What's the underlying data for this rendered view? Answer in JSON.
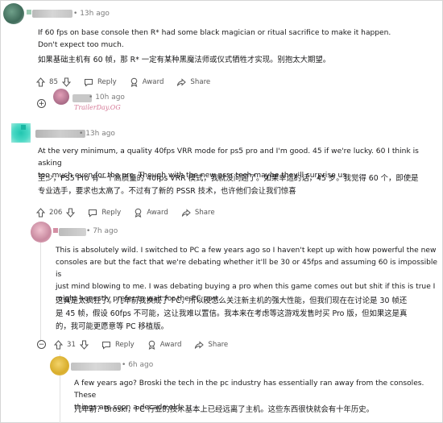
{
  "comments": [
    {
      "time": "13h ago",
      "text_en": "If 60 fps on base console then R* had some black magician or ritual sacrifice to make it happen. Don't expect too much.",
      "text_zh": "如果基础主机有 60 帧，那 R* 一定有某种黑魔法师或仪式牺牲才实现。别抱太大期望。",
      "votes": "85",
      "reply": "Reply",
      "award": "Award",
      "share": "Share"
    },
    {
      "time": "10h ago",
      "flair": "TrailerDay.OG"
    },
    {
      "time": "13h ago",
      "text_en_lines": [
        "At the very minimum, a quality 40fps VRR mode for ps5 pro and I'm good. 45 if we're lucky. 60 I think is asking",
        "too much even for the pro. Though with the new pssr tech maybe they'll surprise us"
      ],
      "text_zh_lines": [
        "至少，PS5 Pro 有一个高质量的 40fps VRR 模式，我就没问题了。如果幸运的话，45 岁。我觉得 60 个，即使是",
        "专业选手，要求也太高了。不过有了新的 PSSR 技术，也许他们会让我们惊喜"
      ],
      "votes": "206",
      "reply": "Reply",
      "award": "Award",
      "share": "Share"
    },
    {
      "time": "7h ago",
      "text_en_lines": [
        "This is absolutely wild. I switched to PC a few years ago so I haven't kept up with how powerful the new",
        "consoles are but the fact that we're debating whether it'll be 30 or 45fps and assuming 60 is impossible is",
        "just mind blowing to me. I was debating buying a pro when this game comes out but shit if this is true I",
        "might honestly prefer to wait for the PC port."
      ],
      "text_zh_lines": [
        "这真是太疯狂了。几年前我换成了 PC，所以没怎么关注新主机的强大性能，但我们现在在讨论是 30 帧还",
        "是 45 帧，假设 60fps 不可能，这让我难以置信。我本来在考虑等这游戏发售时买 Pro 版，但如果这是真",
        "的，我可能更愿意等 PC 移植版。"
      ],
      "collapse": "−",
      "votes": "31",
      "reply": "Reply",
      "award": "Award",
      "share": "Share"
    },
    {
      "time": "6h ago",
      "text_en_lines": [
        "A few years ago? Broski the tech in the pc industry has essentially ran away from the consoles. These",
        "things are soon a decade old."
      ],
      "text_zh": "几年前？Broski，PC 行业的技术基本上已经远离了主机。这些东西很快就会有十年历史。"
    }
  ],
  "expand_symbol": "+",
  "separator": "•",
  "colors": {
    "upvote_outline": "#555555",
    "thread_line": "#e1e1e1",
    "flair": "#d57a97",
    "meta_text": "#7c7c7c"
  }
}
